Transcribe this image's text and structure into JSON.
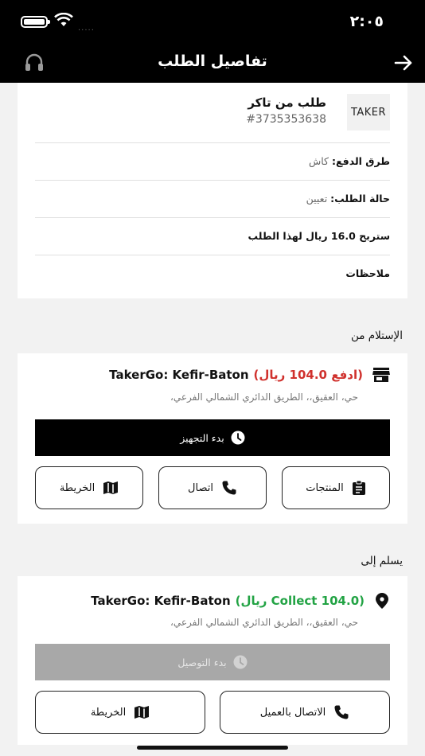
{
  "status_bar": {
    "time": "٢:٠٥",
    "signal": "....."
  },
  "nav": {
    "title": "تفاصيل الطلب"
  },
  "order": {
    "logo_text": "TAKER",
    "title": "طلب من تاكر",
    "number": "#3735353638",
    "payment_label": "طرق الدفع:",
    "payment_value": "كاش",
    "status_label": "حالة الطلب:",
    "status_value": "تعيين",
    "earnings_text": "ستربح 16.0 ريال لهذا الطلب",
    "notes_label": "ملاحظات"
  },
  "pickup": {
    "heading": "الإستلام من",
    "store_name": "TakerGo: Kefir-Baton",
    "payment_text": "(ادفع 104.0 ريال)",
    "address": "حي، العقيق،، الطريق الدائري الشمالي الفرعي،",
    "start_prep_label": "بدء التجهيز",
    "products_label": "المنتجات",
    "call_label": "اتصال",
    "map_label": "الخريطة"
  },
  "deliver": {
    "heading": "يسلم إلى",
    "store_name": "TakerGo: Kefir-Baton",
    "payment_text": "(Collect 104.0 ريال)",
    "address": "حي، العقيق،، الطريق الدائري الشمالي الفرعي،",
    "start_delivery_label": "بدء التوصيل",
    "call_customer_label": "الاتصال بالعميل",
    "map_label": "الخريطة"
  }
}
